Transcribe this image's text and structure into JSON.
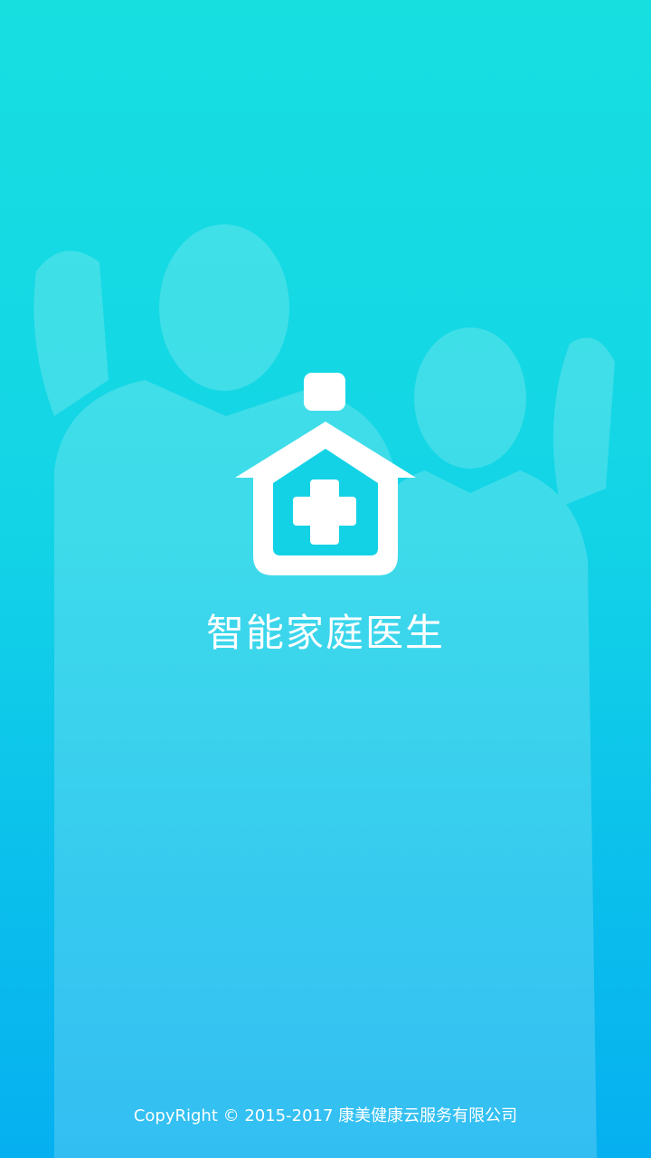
{
  "splash": {
    "app_name": "智能家庭医生",
    "copyright": "CopyRight © 2015-2017 康美健康云服务有限公司",
    "logo_icon": "home-medical-cross-icon",
    "background_image": "doctors-cheering-photo",
    "colors": {
      "gradient_top": "#17dfe0",
      "gradient_bottom": "#06b0f0",
      "text": "#ffffff"
    }
  }
}
